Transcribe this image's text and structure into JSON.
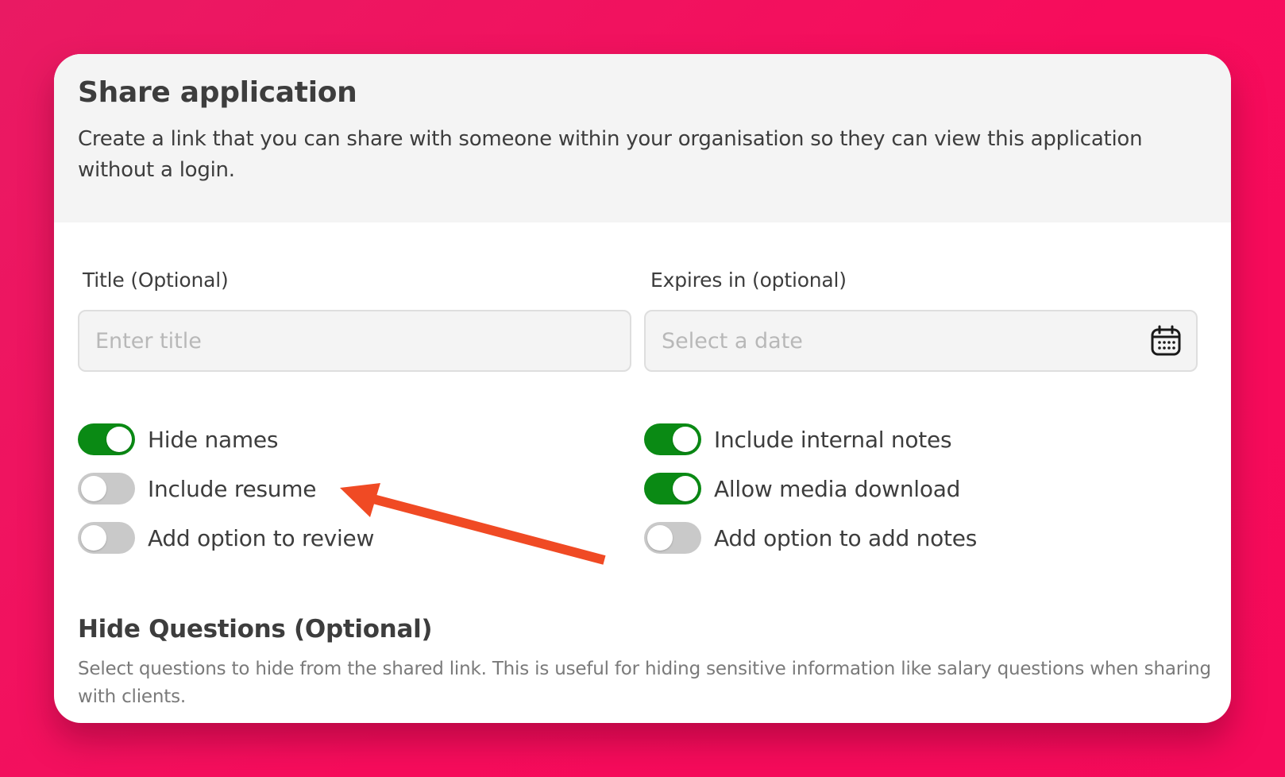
{
  "dialog": {
    "title": "Share application",
    "description": "Create a link that you can share with someone within your organisation so they can view this application without a login."
  },
  "fields": {
    "title": {
      "label": "Title (Optional)",
      "placeholder": "Enter title",
      "value": ""
    },
    "expires": {
      "label": "Expires in (optional)",
      "placeholder": "Select a date",
      "value": "",
      "icon": "calendar-icon"
    }
  },
  "toggles": {
    "left": [
      {
        "label": "Hide names",
        "on": true
      },
      {
        "label": "Include resume",
        "on": false
      },
      {
        "label": "Add option to review",
        "on": false
      }
    ],
    "right": [
      {
        "label": "Include internal notes",
        "on": true
      },
      {
        "label": "Allow media download",
        "on": true
      },
      {
        "label": "Add option to add notes",
        "on": false
      }
    ]
  },
  "hide_questions": {
    "title": "Hide Questions (Optional)",
    "description": "Select questions to hide from the shared link. This is useful for hiding sensitive information like salary questions when sharing with clients."
  },
  "colors": {
    "background": "#f50a5a",
    "toggle_on": "#0a8a14",
    "toggle_off": "#c9c9c9",
    "annotation_arrow": "#f04a24"
  }
}
